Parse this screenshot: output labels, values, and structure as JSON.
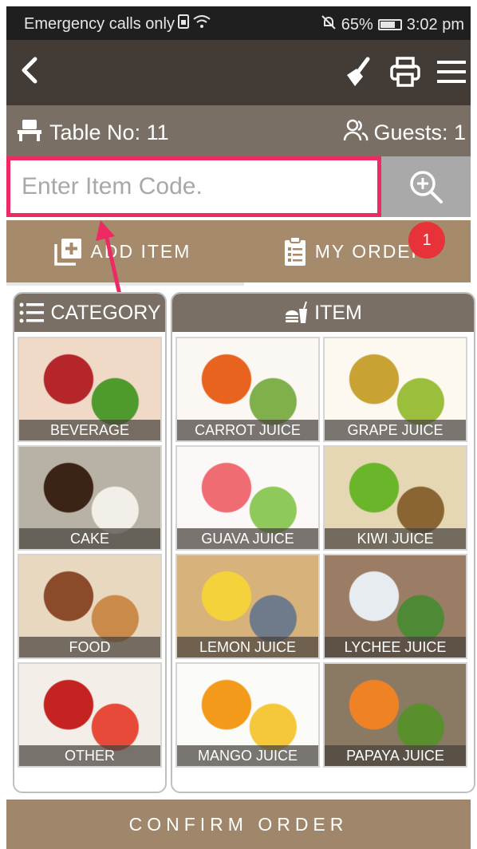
{
  "status": {
    "left_text": "Emergency calls only",
    "battery": "65%",
    "time": "3:02 pm"
  },
  "header": {
    "table_label": "Table No: 11",
    "guests_label": "Guests: 1"
  },
  "search": {
    "placeholder": "Enter Item Code."
  },
  "tabs": {
    "add_item": "ADD ITEM",
    "my_order": "MY ORDER",
    "order_badge": "1"
  },
  "category": {
    "title": "CATEGORY",
    "items": [
      {
        "label": "BEVERAGE",
        "colors": [
          "#b5262b",
          "#4f9a2d",
          "#f0d9c6"
        ]
      },
      {
        "label": "CAKE",
        "colors": [
          "#3b2416",
          "#f1efe8",
          "#b8b2a6"
        ]
      },
      {
        "label": "FOOD",
        "colors": [
          "#8b4a2a",
          "#c98a4a",
          "#e8d8c0"
        ]
      },
      {
        "label": "OTHER",
        "colors": [
          "#c52222",
          "#e84a3a",
          "#f3efe8"
        ]
      }
    ]
  },
  "items": {
    "title": "ITEM",
    "list": [
      {
        "label": "CARROT JUICE",
        "colors": [
          "#e8641e",
          "#7fb04c",
          "#fbf7f2"
        ]
      },
      {
        "label": "GRAPE JUICE",
        "colors": [
          "#c9a234",
          "#9bbf3d",
          "#fdf9f1"
        ]
      },
      {
        "label": "GUAVA JUICE",
        "colors": [
          "#ef6c73",
          "#8ec95a",
          "#fdf8f8"
        ]
      },
      {
        "label": "KIWI JUICE",
        "colors": [
          "#6bb52b",
          "#8a6432",
          "#e5d7b3"
        ]
      },
      {
        "label": "LEMON JUICE",
        "colors": [
          "#f4d23b",
          "#6f7b8a",
          "#d7b27a"
        ]
      },
      {
        "label": "LYCHEE JUICE",
        "colors": [
          "#e6ecef",
          "#4e8a35",
          "#9a7d64"
        ]
      },
      {
        "label": "MANGO JUICE",
        "colors": [
          "#f39a1b",
          "#f7c73a",
          "#fbfbf8"
        ]
      },
      {
        "label": "PAPAYA JUICE",
        "colors": [
          "#f08226",
          "#5a8f2e",
          "#8a7a63"
        ]
      }
    ]
  },
  "footer": {
    "confirm": "CONFIRM ORDER"
  }
}
